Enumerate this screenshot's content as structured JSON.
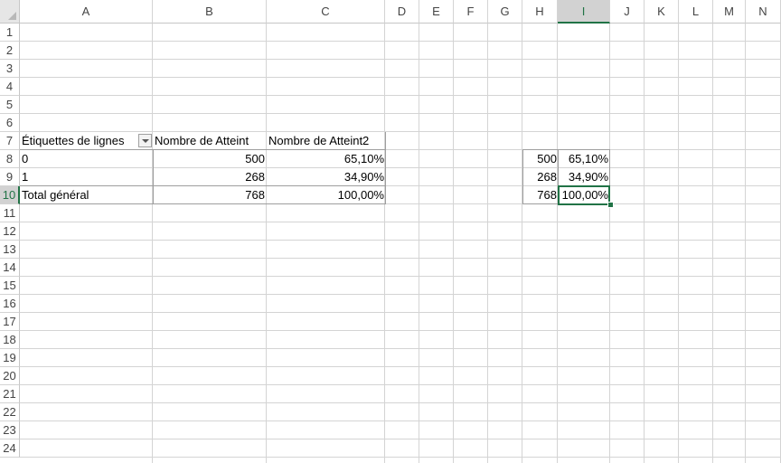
{
  "columns": [
    "A",
    "B",
    "C",
    "D",
    "E",
    "F",
    "G",
    "H",
    "I",
    "J",
    "K",
    "L",
    "M",
    "N"
  ],
  "rows": [
    "1",
    "2",
    "3",
    "4",
    "5",
    "6",
    "7",
    "8",
    "9",
    "10",
    "11",
    "12",
    "13",
    "14",
    "15",
    "16",
    "17",
    "18",
    "19",
    "20",
    "21",
    "22",
    "23",
    "24"
  ],
  "pivot": {
    "header_row_labels": "Étiquettes de lignes",
    "header_count": "Nombre de Atteint",
    "header_percent": "Nombre de Atteint2",
    "rows": [
      {
        "label": "0",
        "count": "500",
        "percent": "65,10%"
      },
      {
        "label": "1",
        "count": "268",
        "percent": "34,90%"
      }
    ],
    "total": {
      "label": "Total général",
      "count": "768",
      "percent": "100,00%"
    }
  },
  "side_table": [
    {
      "count": "500",
      "percent": "65,10%"
    },
    {
      "count": "268",
      "percent": "34,90%"
    },
    {
      "count": "768",
      "percent": "100,00%"
    }
  ],
  "selection": {
    "column": "I",
    "row": "10"
  },
  "colors": {
    "accent": "#217346",
    "gridline": "#d4d4d4",
    "header_selected_bg": "#d2d2d2"
  }
}
